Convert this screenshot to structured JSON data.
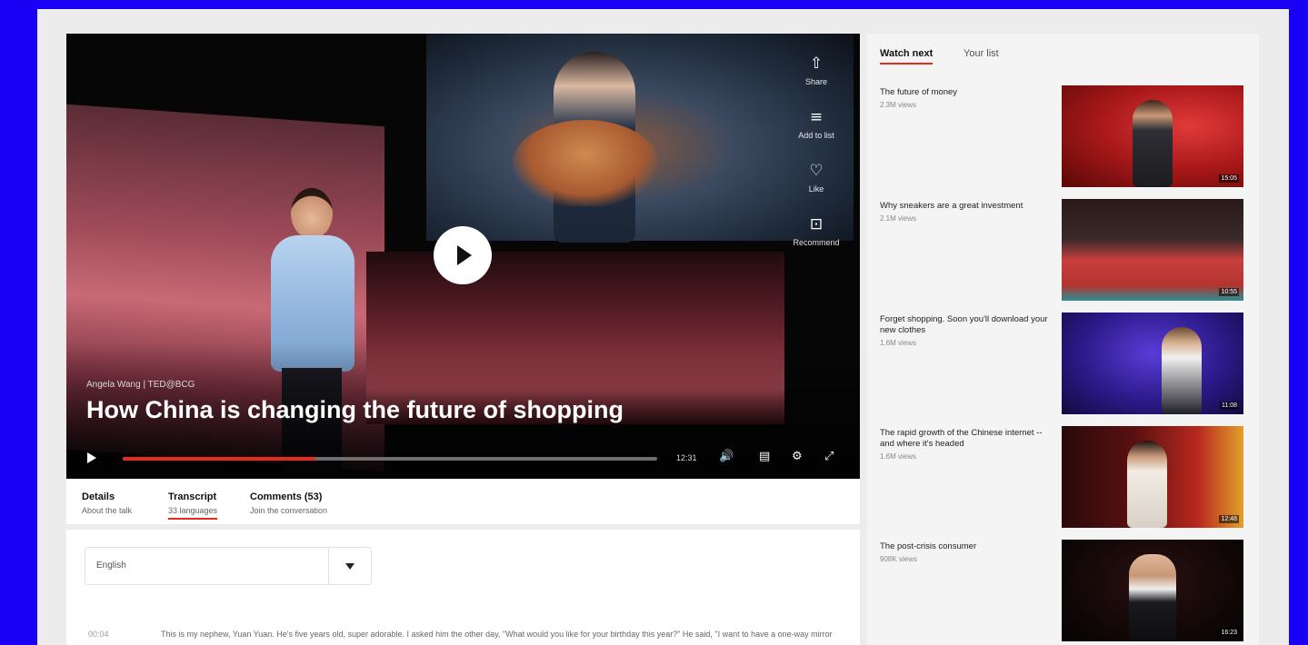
{
  "video": {
    "speaker": "Angela Wang | TED@BCG",
    "title": "How China is changing the future of shopping",
    "time": "12:31",
    "progress_percent": 36,
    "actions": [
      {
        "icon": "share-icon",
        "glyph": "⇧",
        "label": "Share"
      },
      {
        "icon": "add-to-list-icon",
        "glyph": "≡",
        "label": "Add to list"
      },
      {
        "icon": "heart-icon",
        "glyph": "♡",
        "label": "Like"
      },
      {
        "icon": "recommend-icon",
        "glyph": "⊡",
        "label": "Recommend"
      }
    ]
  },
  "tabs": [
    {
      "label": "Details",
      "sub": "About the talk"
    },
    {
      "label": "Transcript",
      "sub": "33 languages"
    },
    {
      "label": "Comments (53)",
      "sub": "Join the conversation"
    }
  ],
  "transcript": {
    "language": "English",
    "timestamp": "00:04",
    "text": "This is my nephew, Yuan Yuan. He's five years old, super adorable. I asked him the other day, \"What would you like for your birthday this year?\" He said, \"I want to have a one-way mirror Spider-Man mask.\" I had absolutely no idea what he was talking about, so I went"
  },
  "sidebar": {
    "tabs": [
      "Watch next",
      "Your list"
    ],
    "items": [
      {
        "title": "The future of money",
        "views": "2.3M views",
        "duration": "15:05"
      },
      {
        "title": "Why sneakers are a great investment",
        "views": "2.1M views",
        "duration": "10:55"
      },
      {
        "title": "Forget shopping. Soon you'll download your new clothes",
        "views": "1.6M views",
        "duration": "11:08"
      },
      {
        "title": "The rapid growth of the Chinese internet -- and where it's headed",
        "views": "1.6M views",
        "duration": "12:48"
      },
      {
        "title": "The post-crisis consumer",
        "views": "908K views",
        "duration": "16:23"
      }
    ]
  }
}
